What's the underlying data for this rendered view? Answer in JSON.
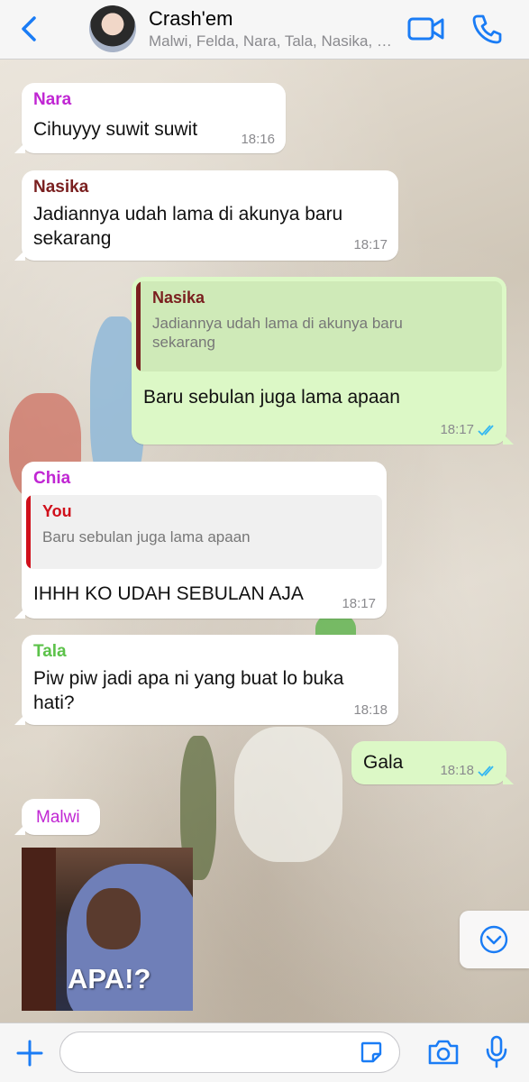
{
  "header": {
    "title": "Crash'em",
    "subtitle": "Malwi, Felda, Nara, Tala, Nasika, Chia, You"
  },
  "messages": [
    {
      "type": "in",
      "sender": "Nara",
      "sender_color": "#c026d3",
      "text": "Cihuyyy suwit suwit",
      "time": "18:16"
    },
    {
      "type": "in",
      "sender": "Nasika",
      "sender_color": "#7a1f1f",
      "text_line1": "Jadiannya udah lama di akunya baru",
      "text_line2": "sekarang",
      "time": "18:17"
    },
    {
      "type": "out",
      "quote_name": "Nasika",
      "quote_color": "#7a1f1f",
      "quote_line1": "Jadiannya udah lama di akunya baru",
      "quote_line2": "sekarang",
      "text": "Baru sebulan juga lama apaan",
      "time": "18:17"
    },
    {
      "type": "in",
      "sender": "Chia",
      "sender_color": "#c026d3",
      "quote_name": "You",
      "quote_color": "#d0101b",
      "quote_text": "Baru sebulan juga lama apaan",
      "text": "IHHH KO UDAH SEBULAN AJA",
      "time": "18:17"
    },
    {
      "type": "in",
      "sender": "Tala",
      "sender_color": "#5cc24a",
      "text_line1": "Piw piw jadi apa ni yang buat lo buka",
      "text_line2": "hati?",
      "time": "18:18"
    },
    {
      "type": "out",
      "text": "Gala",
      "time": "18:18"
    },
    {
      "type": "in",
      "sender": "Malwi",
      "sender_color": "#c026d3",
      "sticker_caption": "APA!?"
    }
  ],
  "colors": {
    "tick": "#34b7f1",
    "accent": "#1a7cf5"
  },
  "input": {
    "placeholder": ""
  }
}
